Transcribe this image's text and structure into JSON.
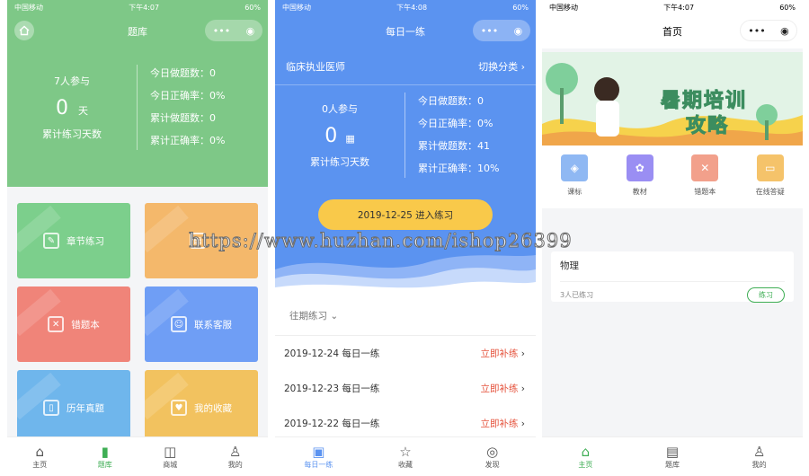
{
  "status": {
    "carrier": "中国移动",
    "time1": "下午4:07",
    "time2": "下午4:08",
    "time3": "下午4:07",
    "battery": "60%"
  },
  "p1": {
    "title": "题库",
    "participants": "7人参与",
    "days_value": "0",
    "days_unit": "天",
    "days_label": "累计练习天数",
    "stats": [
      {
        "label": "今日做题数：",
        "value": "0"
      },
      {
        "label": "今日正确率：",
        "value": "0%"
      },
      {
        "label": "累计做题数：",
        "value": "0"
      },
      {
        "label": "累计正确率：",
        "value": "0%"
      }
    ],
    "tiles": [
      {
        "label": "章节练习",
        "color": "#7ccf8c",
        "icon": "✎"
      },
      {
        "label": "",
        "color": "#f4b86b",
        "icon": "▤"
      },
      {
        "label": "错题本",
        "color": "#f08479",
        "icon": "✕"
      },
      {
        "label": "联系客服",
        "color": "#6f9ef5",
        "icon": "☺"
      },
      {
        "label": "历年真题",
        "color": "#6fb6ec",
        "icon": "▯"
      },
      {
        "label": "我的收藏",
        "color": "#f2c25f",
        "icon": "♥"
      }
    ],
    "tabs": [
      {
        "label": "主页",
        "icon": "⌂",
        "active": false
      },
      {
        "label": "题库",
        "icon": "▮",
        "active": true
      },
      {
        "label": "商城",
        "icon": "◫",
        "active": false
      },
      {
        "label": "我的",
        "icon": "♙",
        "active": false
      }
    ]
  },
  "p2": {
    "title": "每日一练",
    "category": "临床执业医师",
    "switch": "切换分类",
    "participants": "0人参与",
    "days_value": "0",
    "days_label": "累计练习天数",
    "stats": [
      {
        "label": "今日做题数：",
        "value": "0"
      },
      {
        "label": "今日正确率：",
        "value": "0%"
      },
      {
        "label": "累计做题数：",
        "value": "41"
      },
      {
        "label": "累计正确率：",
        "value": "10%"
      }
    ],
    "enter": "2019-12-25   进入练习",
    "past_header": "往期练习",
    "past": [
      {
        "date": "2019-12-24 每日一练",
        "action": "立即补练"
      },
      {
        "date": "2019-12-23 每日一练",
        "action": "立即补练"
      },
      {
        "date": "2019-12-22 每日一练",
        "action": "立即补练"
      }
    ],
    "tabs": [
      {
        "label": "每日一练",
        "icon": "▣",
        "active": true
      },
      {
        "label": "收藏",
        "icon": "☆",
        "active": false
      },
      {
        "label": "发现",
        "icon": "◎",
        "active": false
      }
    ]
  },
  "p3": {
    "title": "首页",
    "banner_text1": "暑期培训",
    "banner_text2": "攻略",
    "shortcuts": [
      {
        "label": "课标",
        "color": "#8fb8f3",
        "icon": "◈"
      },
      {
        "label": "教材",
        "color": "#9a8ef3",
        "icon": "✿"
      },
      {
        "label": "错题本",
        "color": "#f2a08b",
        "icon": "✕"
      },
      {
        "label": "在线答疑",
        "color": "#f5c36a",
        "icon": "▭"
      }
    ],
    "card_title": "物理",
    "card_count": "3人已练习",
    "card_btn": "练习",
    "tabs": [
      {
        "label": "主页",
        "icon": "⌂",
        "active": true
      },
      {
        "label": "题库",
        "icon": "▤",
        "active": false
      },
      {
        "label": "我的",
        "icon": "♙",
        "active": false
      }
    ]
  },
  "watermark": "https://www.huzhan.com/ishop26399"
}
